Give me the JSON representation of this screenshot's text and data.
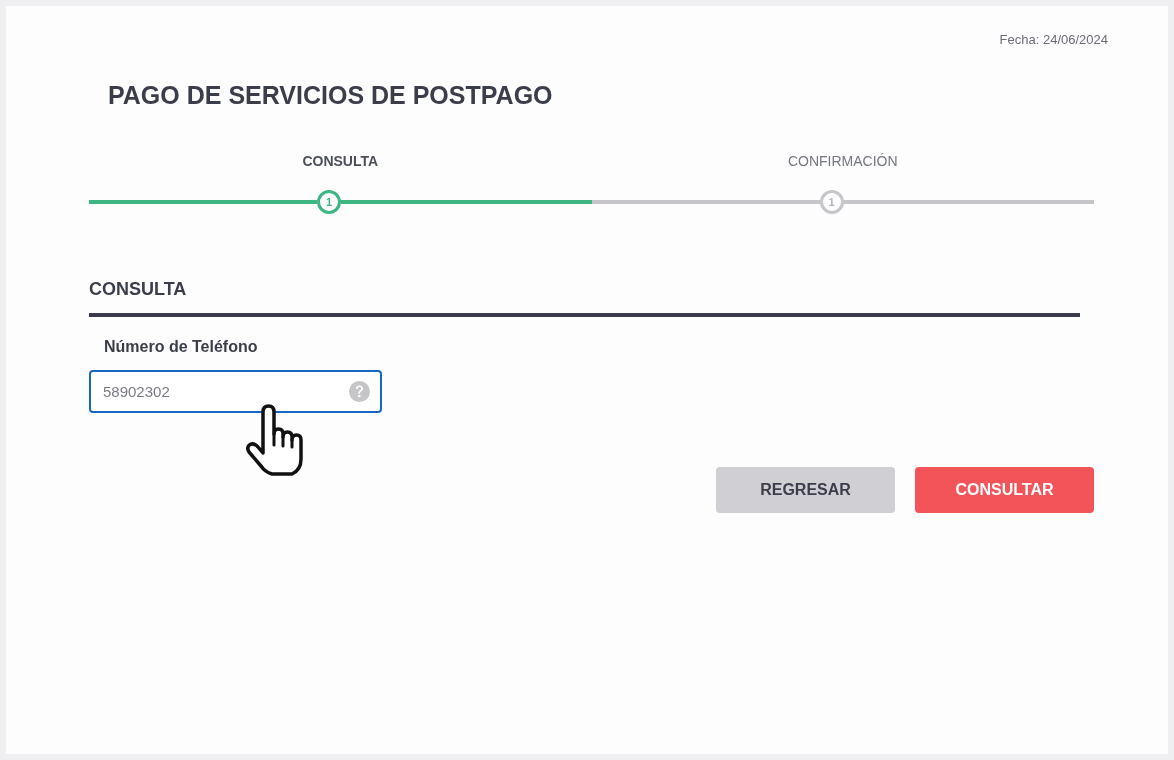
{
  "date": "Fecha: 24/06/2024",
  "title": "PAGO DE SERVICIOS DE POSTPAGO",
  "steps": [
    {
      "label": "CONSULTA",
      "number": "1",
      "selected": true
    },
    {
      "label": "CONFIRMACIÓN",
      "number": "1",
      "selected": false
    }
  ],
  "section": {
    "title": "CONSULTA",
    "fields": [
      {
        "label": "Número de Teléfono",
        "value": "58902302",
        "focused": true
      }
    ]
  },
  "buttons": [
    {
      "label": "REGRESAR",
      "kind": "secondary"
    },
    {
      "label": "CONSULTAR",
      "kind": "primary"
    }
  ]
}
